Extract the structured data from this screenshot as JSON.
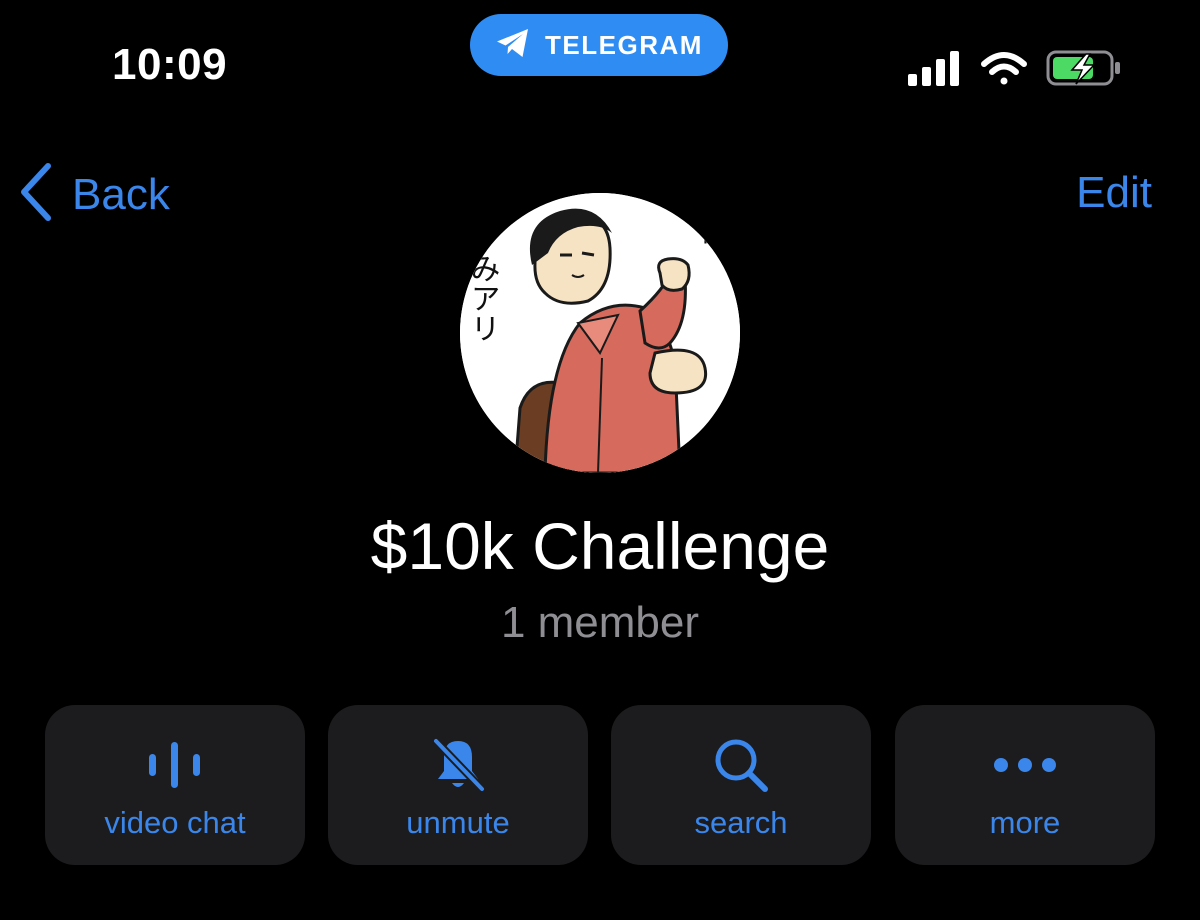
{
  "status_bar": {
    "time": "10:09",
    "app_pill_label": "TELEGRAM",
    "battery_state": "charging"
  },
  "nav": {
    "back_label": "Back",
    "edit_label": "Edit"
  },
  "group": {
    "title": "$10k Challenge",
    "subtitle": "1 member",
    "avatar_text": "みアリ"
  },
  "actions": [
    {
      "label": "video chat",
      "icon": "voice-chat-icon"
    },
    {
      "label": "unmute",
      "icon": "bell-slash-icon"
    },
    {
      "label": "search",
      "icon": "search-icon"
    },
    {
      "label": "more",
      "icon": "more-dots-icon"
    }
  ],
  "colors": {
    "background": "#000000",
    "accent": "#3a86ea",
    "pill": "#2f8cf3",
    "button_bg": "#1c1c1e",
    "subtitle": "#8e8e93",
    "battery_fill": "#4cd964"
  }
}
